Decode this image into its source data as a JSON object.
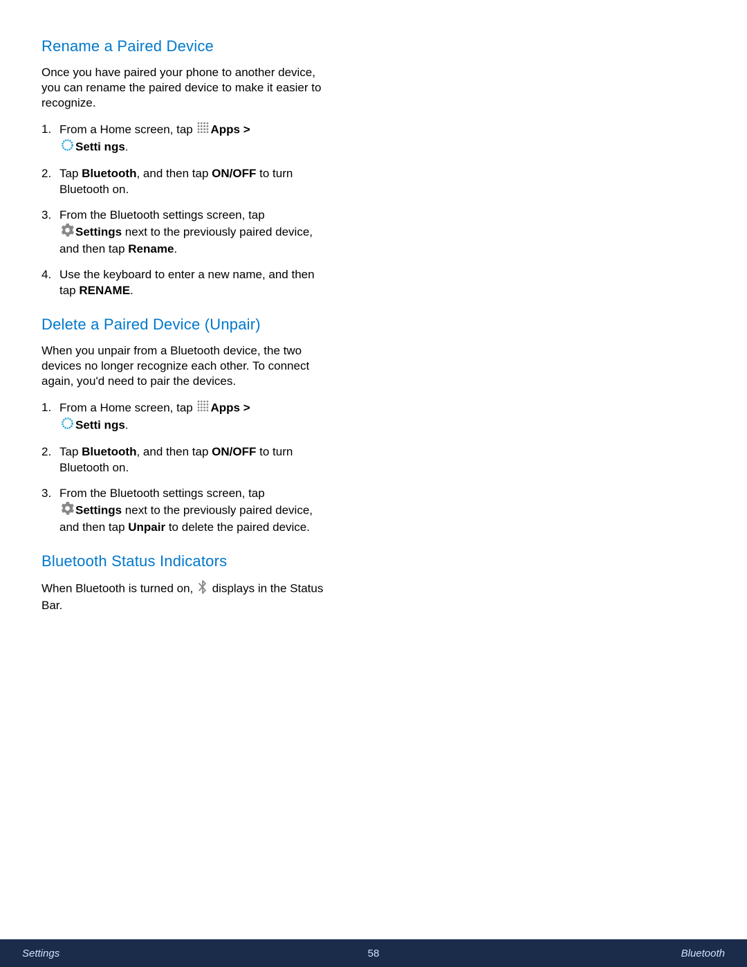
{
  "sections": {
    "rename": {
      "heading": "Rename a Paired Device",
      "intro": "Once you have paired your phone to another device, you can rename the paired device to make it easier to recognize.",
      "steps": {
        "s1_prefix": "From a Home screen, tap ",
        "s1_apps": "Apps",
        "s1_gt": " > ",
        "s1_settings": "Setti ngs",
        "s1_period": ".",
        "s2_a": "Tap ",
        "s2_bt": "Bluetooth",
        "s2_b": ", and then tap ",
        "s2_onoff": "ON/OFF",
        "s2_c": " to turn Bluetooth on.",
        "s3_a": "From the Bluetooth settings screen, tap ",
        "s3_settings": "Settings",
        "s3_b": " next to the previously paired device, and then tap ",
        "s3_rename": "Rename",
        "s3_c": ".",
        "s4_a": "Use the keyboard to enter a new name, and then tap ",
        "s4_rename": "RENAME",
        "s4_b": "."
      }
    },
    "delete": {
      "heading": "Delete a Paired Device (Unpair)",
      "intro": "When you unpair from a Bluetooth device, the two devices no longer recognize each other. To connect again, you'd need to pair the devices.",
      "steps": {
        "s1_prefix": "From a Home screen, tap ",
        "s1_apps": "Apps",
        "s1_gt": " > ",
        "s1_settings": "Setti ngs",
        "s1_period": ".",
        "s2_a": "Tap ",
        "s2_bt": "Bluetooth",
        "s2_b": ", and then tap ",
        "s2_onoff": "ON/OFF",
        "s2_c": " to turn Bluetooth on.",
        "s3_a": "From the Bluetooth settings screen, tap ",
        "s3_settings": "Settings",
        "s3_b": " next to the previously paired device, and then tap ",
        "s3_unpair": "Unpair",
        "s3_c": " to delete the paired device."
      }
    },
    "status": {
      "heading": "Bluetooth Status Indicators",
      "text_a": "When Bluetooth is turned on, ",
      "text_b": " displays in the Status Bar."
    }
  },
  "footer": {
    "left": "Settings",
    "center": "58",
    "right": "Bluetooth"
  }
}
